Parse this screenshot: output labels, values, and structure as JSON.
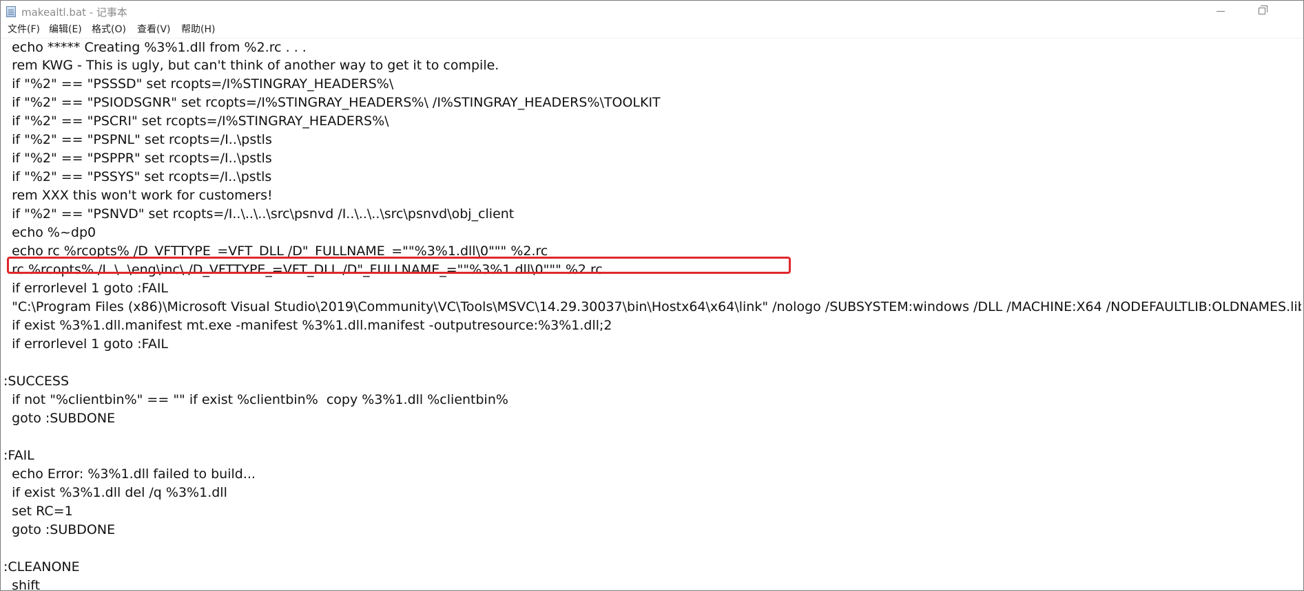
{
  "window": {
    "title": "makealtl.bat - 记事本",
    "icon": "notepad-icon"
  },
  "menu": {
    "items": [
      {
        "label": "文件(F)"
      },
      {
        "label": "编辑(E)"
      },
      {
        "label": "格式(O)"
      },
      {
        "label": "查看(V)"
      },
      {
        "label": "帮助(H)"
      }
    ]
  },
  "editor": {
    "lines": [
      "  echo ***** Creating %3%1.dll from %2.rc . . .",
      "  rem KWG - This is ugly, but can't think of another way to get it to compile.",
      "  if \"%2\" == \"PSSSD\" set rcopts=/I%STINGRAY_HEADERS%\\",
      "  if \"%2\" == \"PSIODSGNR\" set rcopts=/I%STINGRAY_HEADERS%\\ /I%STINGRAY_HEADERS%\\TOOLKIT",
      "  if \"%2\" == \"PSCRI\" set rcopts=/I%STINGRAY_HEADERS%\\",
      "  if \"%2\" == \"PSPNL\" set rcopts=/I..\\pstls",
      "  if \"%2\" == \"PSPPR\" set rcopts=/I..\\pstls",
      "  if \"%2\" == \"PSSYS\" set rcopts=/I..\\pstls",
      "  rem XXX this won't work for customers!",
      "  if \"%2\" == \"PSNVD\" set rcopts=/I..\\..\\..\\src\\psnvd /I..\\..\\..\\src\\psnvd\\obj_client",
      "  echo %~dp0",
      "  echo rc %rcopts% /D_VFTTYPE_=VFT_DLL /D\"_FULLNAME_=\"\"%3%1.dll\\0\"\"\" %2.rc",
      "  rc %rcopts% /I..\\..\\eng\\inc\\ /D_VFTTYPE_=VFT_DLL /D\"_FULLNAME_=\"\"%3%1.dll\\0\"\"\" %2.rc",
      "  if errorlevel 1 goto :FAIL",
      "  \"C:\\Program Files (x86)\\Microsoft Visual Studio\\2019\\Community\\VC\\Tools\\MSVC\\14.29.30037\\bin\\Hostx64\\x64\\link\" /nologo /SUBSYSTEM:windows /DLL /MACHINE:X64 /NODEFAULTLIB:OLDNAMES.lib",
      "  if exist %3%1.dll.manifest mt.exe -manifest %3%1.dll.manifest -outputresource:%3%1.dll;2",
      "  if errorlevel 1 goto :FAIL",
      "",
      ":SUCCESS",
      "  if not \"%clientbin%\" == \"\" if exist %clientbin%  copy %3%1.dll %clientbin%",
      "  goto :SUBDONE",
      "",
      ":FAIL",
      "  echo Error: %3%1.dll failed to build...",
      "  if exist %3%1.dll del /q %3%1.dll",
      "  set RC=1",
      "  goto :SUBDONE",
      "",
      ":CLEANONE",
      "  shift"
    ]
  },
  "annotation": {
    "color": "#e0272c"
  }
}
